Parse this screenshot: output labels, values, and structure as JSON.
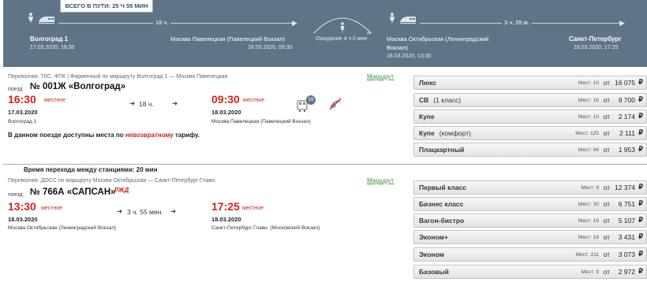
{
  "header": {
    "total_time": "ВСЕГО В ПУТИ: 25 Ч 55 МИН",
    "leg1_duration": "18 ч.",
    "leg2_duration": "3 ч. 55 м.",
    "wait_text": "Ожидание 4 ч 0 мин",
    "origin": {
      "name": "Волгоград 1",
      "datetime": "17.03.2020, 16:30"
    },
    "transfer_arrival": {
      "name": "Москва Павелецкая (Павелецкий Вокзал)",
      "datetime": "18.03.2020, 09:30"
    },
    "transfer_departure": {
      "name_line1": "Москва Октябрьская (Ленинградский",
      "name_line2": "Вокзал)",
      "datetime": "18.03.2020, 13:30"
    },
    "destination": {
      "name": "Санкт-Петербург",
      "datetime": "18.03.2020, 17:25"
    },
    "header_color": "#5f7587"
  },
  "segment1": {
    "carrier": "Перевозчик: ТКС, ФПК | Фирменный    по маршруту Волгоград 1 — Москва Павелецкая",
    "route_link": "Маршрут",
    "train_word": "поезд",
    "train_name": "№ 001Ж «Волгоград»",
    "dep_time": "16:30",
    "dep_local": "местное",
    "dep_date": "17.03.2020",
    "dep_station": "Волгоград 1",
    "duration": "18 ч.",
    "arr_time": "09:30",
    "arr_local": "местное",
    "arr_date": "18.03.2020",
    "arr_station": "Москва Павелецкая (Павелецкий Вокзал)",
    "icon_badge": "16",
    "notice_before": "В данном поезде доступны места по ",
    "notice_red": "невозвратному",
    "notice_after": " тарифу.",
    "fares": [
      {
        "cls": "Люкс",
        "sub": "",
        "seats": "Мест: 10",
        "from": "от",
        "price": "16 075",
        "rub": "₽"
      },
      {
        "cls": "СВ",
        "sub": "(1 класс)",
        "seats": "Мест: 16",
        "from": "от",
        "price": "9 700",
        "rub": "₽"
      },
      {
        "cls": "Купе",
        "sub": "",
        "seats": "Мест: 10",
        "from": "от",
        "price": "2 174",
        "rub": "₽"
      },
      {
        "cls": "Купе",
        "sub": "(комфорт)",
        "seats": "Мест: 125",
        "from": "от",
        "price": "2 111",
        "rub": "₽"
      },
      {
        "cls": "Плацкартный",
        "sub": "",
        "seats": "Мест: 94",
        "from": "от",
        "price": "1 953",
        "rub": "₽"
      }
    ]
  },
  "transfer_text": "Время перехода между станциями: 20 мин",
  "segment2": {
    "carrier": "Перевозчик: ДОСС    по маршруту Москва Октябрьская — Санкт-Петербург-Главн.",
    "route_link": "Маршрут",
    "train_word": "поезд",
    "train_name": "№ 766А «САПСАН»",
    "rzd_logo": "РЖД",
    "dep_time": "13:30",
    "dep_local": "местное",
    "dep_date": "18.03.2020",
    "dep_station": "Москва Октябрьская (Ленинградский Вокзал)",
    "duration": "3 ч. 55 мин.",
    "arr_time": "17:25",
    "arr_local": "местное",
    "arr_date": "18.03.2020",
    "arr_station": "Санкт-Петербург-Главн. (Московский Вокзал)",
    "fares": [
      {
        "cls": "Первый класс",
        "sub": "",
        "seats": "Мест: 9",
        "from": "от",
        "price": "12 374",
        "rub": "₽"
      },
      {
        "cls": "Бизнес класс",
        "sub": "",
        "seats": "Мест: 30",
        "from": "от",
        "price": "6 751",
        "rub": "₽"
      },
      {
        "cls": "Вагон-бистро",
        "sub": "",
        "seats": "Мест: 19",
        "from": "от",
        "price": "5 107",
        "rub": "₽"
      },
      {
        "cls": "Эконом+",
        "sub": "",
        "seats": "Мест: 16",
        "from": "от",
        "price": "3 431",
        "rub": "₽"
      },
      {
        "cls": "Эконом",
        "sub": "",
        "seats": "Мест: 211",
        "from": "от",
        "price": "3 073",
        "rub": "₽"
      },
      {
        "cls": "Базовый",
        "sub": "",
        "seats": "Мест: 9",
        "from": "от",
        "price": "2 972",
        "rub": "₽"
      }
    ]
  },
  "colors": {
    "time_red": "#d4211c",
    "link_green": "#3d8f3d"
  }
}
